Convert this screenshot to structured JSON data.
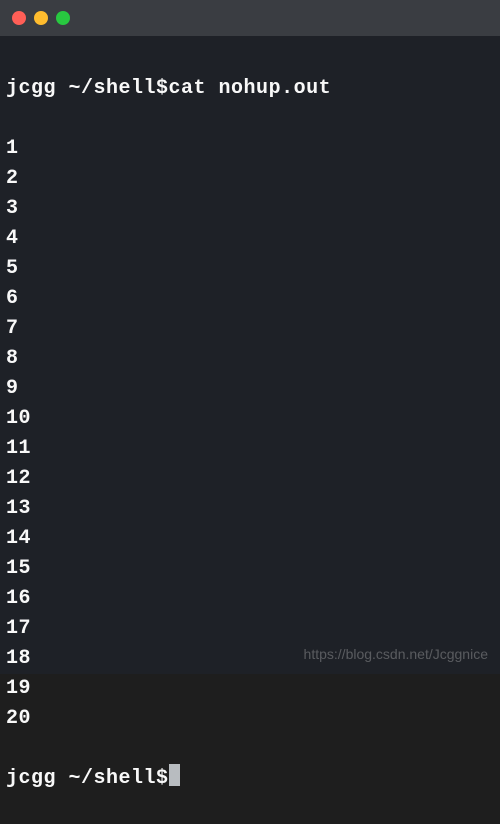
{
  "titlebar": {
    "close": "close",
    "minimize": "minimize",
    "maximize": "maximize"
  },
  "terminal": {
    "prompt1": {
      "user": "jcgg",
      "path": " ~/shell",
      "symbol": "$",
      "command": "cat nohup.out"
    },
    "output": [
      "1",
      "2",
      "3",
      "4",
      "5",
      "6",
      "7",
      "8",
      "9",
      "10",
      "11",
      "12",
      "13",
      "14",
      "15",
      "16",
      "17",
      "18",
      "19",
      "20"
    ],
    "prompt2": {
      "user": "jcgg",
      "path": " ~/shell",
      "symbol": "$"
    }
  },
  "watermark": "https://blog.csdn.net/Jcggnice"
}
